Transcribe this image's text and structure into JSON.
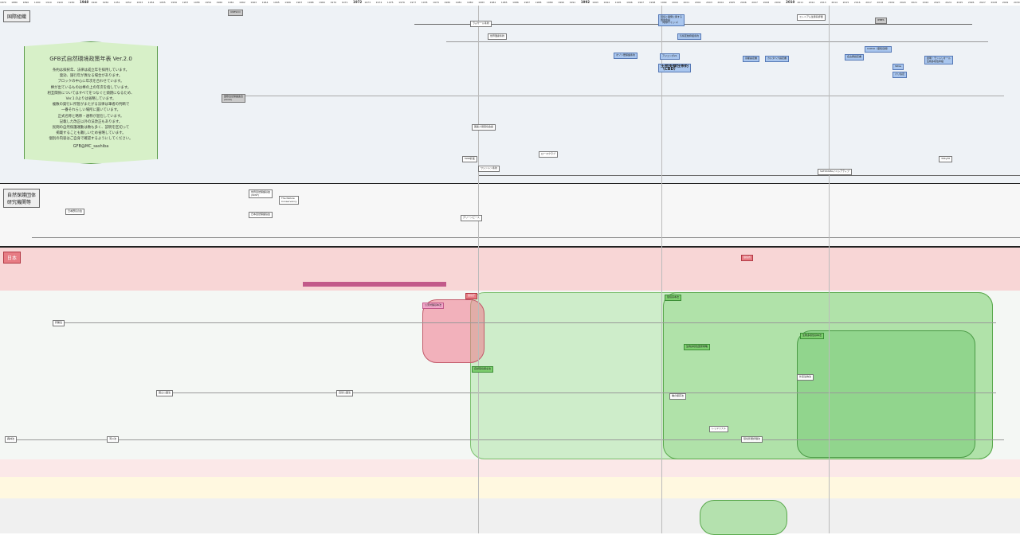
{
  "years": {
    "labels": [
      "1870",
      "1880",
      "1890",
      "1900",
      "1910",
      "1920",
      "1930",
      "1948",
      "1949",
      "1950",
      "1951",
      "1952",
      "1953",
      "1954",
      "1955",
      "1956",
      "1957",
      "1958",
      "1959",
      "1960",
      "1961",
      "1962",
      "1963",
      "1964",
      "1965",
      "1966",
      "1967",
      "1968",
      "1969",
      "1970",
      "1971",
      "1972",
      "1973",
      "1974",
      "1975",
      "1976",
      "1977",
      "1978",
      "1979",
      "1980",
      "1981",
      "1982",
      "1983",
      "1984",
      "1985",
      "1986",
      "1987",
      "1988",
      "1989",
      "1990",
      "1991",
      "1992",
      "1993",
      "1994",
      "1995",
      "1996",
      "1997",
      "1998",
      "1999",
      "2000",
      "2001",
      "2002",
      "2003",
      "2004",
      "2005",
      "2006",
      "2007",
      "2008",
      "2009",
      "2010",
      "2011",
      "2012",
      "2013",
      "2014",
      "2015",
      "2016",
      "2017",
      "2018",
      "2019",
      "2020",
      "2021",
      "2022",
      "2023",
      "2024",
      "2025",
      "2026",
      "2027",
      "2028",
      "2029",
      "2030"
    ],
    "major": [
      "1948",
      "1972",
      "1992",
      "2010"
    ]
  },
  "bands": {
    "international": "国際組織",
    "ngo": "自然保護団体\n研究機関等",
    "japan": "日本"
  },
  "legend": {
    "title": "GFB式自然環境政策年表 Ver.2.0",
    "lines": [
      "条約は採択年、法律は成立年を採用しています。",
      "発効、施行年が異なる場合があります。",
      "ブロックの中心に年次を合わせています。",
      "棒が出ているものは棒の上の年次を指しています。",
      "相互関係についてはすべてをつなぐと煩雑になるため、",
      "Ver.1.0よりは省略しています。",
      "複数の発行に所管がまたがる法律は筆者の判断で",
      "一番それらしい場所に置いています。",
      "正式名称と略称・通称が混在しています。",
      "記載した改正以外の法改正もあります。",
      "民間の自然保護運動は数も多く、説明を区切って",
      "掲載することも難しいため省略しています。",
      "個別の内容はご自身で確認するようにしてください。"
    ],
    "credit": "GFB@MC_sashiba"
  },
  "boxes": {
    "cbd": "生物多様性条約\n（CBD）",
    "earth_summit": "環境と開発に関する\n国連会議\n（地球サミット）",
    "unesco": "UNESCO",
    "iucn": "国際自然保護連合\n(IUCN)",
    "ramsar": "ラムサール条約",
    "cites": "ワシントン条約",
    "whc": "世界遺産条約",
    "stockholm": "国連人間環境会議",
    "club_rome": "ローマクラブ",
    "wwf": "世界自然保護基金\n(WWF)",
    "nature_conservancy": "The Nature\nConservancy",
    "wbsj": "日本野鳥の会",
    "nacsj": "日本自然保護協会",
    "greenpeace": "グリーンピース",
    "env_agency": "環境庁",
    "env_ministry": "環境省",
    "basic_env_law": "環境基本法",
    "pollution_law": "公害対策基本法",
    "nature_cons_law": "自然環境保全法",
    "biodiv_basic": "生物多様性基本法",
    "nbsap": "生物多様性国家戦略",
    "species_law": "種の保存法",
    "alien_law": "外来生物法",
    "parks_law": "自然公園法",
    "national_park": "国立公園法",
    "hunting_law": "狩猟法",
    "forest_law": "森林法",
    "river_law": "河川法",
    "cop10": "COP10（愛知目標）",
    "sdgs": "SDGs",
    "paris": "パリ協定",
    "30by30": "30by30",
    "ipbes": "IPBES",
    "kunming": "昆明・モントリオール\n生物多様性枠組",
    "red_list": "レッドリスト",
    "eia_law": "環境影響評価法",
    "satoyama": "SATOYAMAイニシアティブ",
    "mab": "MAB計画",
    "millennium": "ミレニアム生態系評価",
    "ozone": "オゾン層保護条約",
    "unfccc": "気候変動枠組条約",
    "kyoto": "京都議定書",
    "nagoya": "名古屋議定書",
    "cartagena": "カルタヘナ議定書",
    "agenda21": "アジェンダ21"
  }
}
